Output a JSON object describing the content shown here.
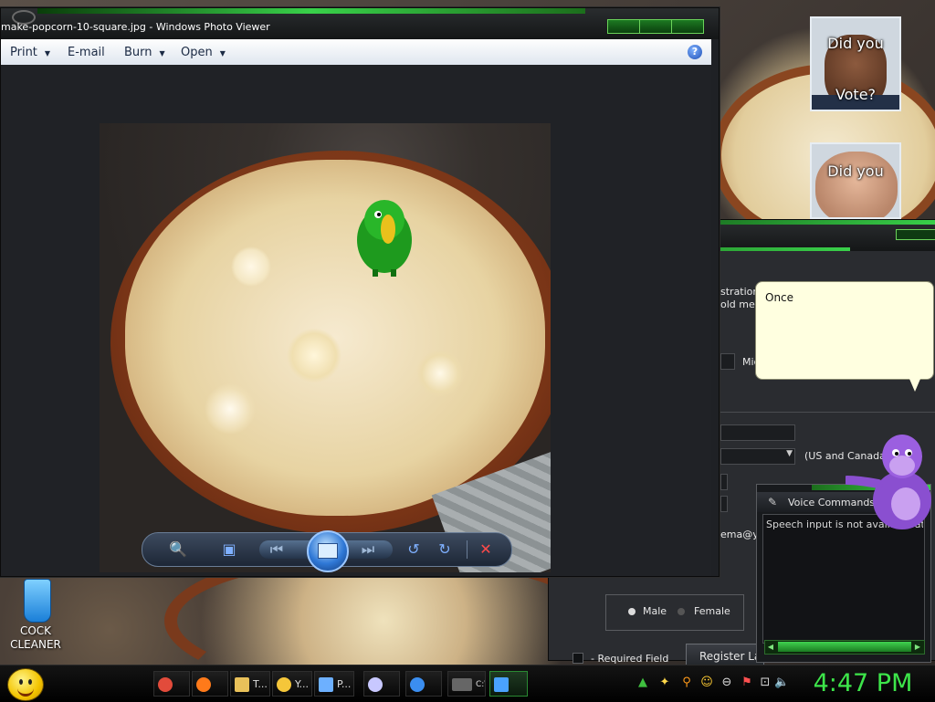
{
  "viewer": {
    "title": "make-popcorn-10-square.jpg - Windows Photo Viewer",
    "menu": [
      {
        "label": "Print",
        "has_arrow": true
      },
      {
        "label": "E-mail",
        "has_arrow": false
      },
      {
        "label": "Burn",
        "has_arrow": true
      },
      {
        "label": "Open",
        "has_arrow": true
      }
    ],
    "help_icon": "?",
    "toolbar": {
      "zoom_icon": "magnifier-icon",
      "fit_icon": "actual-size-icon",
      "prev_icon": "previous-icon",
      "slideshow_icon": "slideshow-icon",
      "next_icon": "next-icon",
      "rotate_ccw_icon": "rotate-counterclockwise-icon",
      "rotate_cw_icon": "rotate-clockwise-icon",
      "delete_icon": "delete-icon"
    }
  },
  "thumbs": [
    {
      "text_top": "Did you",
      "text_bottom": "Vote?"
    },
    {
      "text_top": "Did you"
    }
  ],
  "registration": {
    "line1": "stration i",
    "line2": "old me!",
    "mic_label": "Mic",
    "region_note": "(US and Canada Onl",
    "email_partial": "ema@y",
    "male": "Male",
    "female": "Female",
    "required_field": "- Required Field",
    "register_later": "Register Late"
  },
  "bubble": {
    "text": "Once"
  },
  "voice": {
    "title": "Voice Commands ...",
    "status": "Speech input is not available at this"
  },
  "desktop_icon": {
    "label_line1": "COCK",
    "label_line2": "CLEANER"
  },
  "taskbar": {
    "tasks": [
      {
        "name": "chrome",
        "label": "",
        "color": "#e24b3b"
      },
      {
        "name": "firefox",
        "label": "",
        "color": "#ff7a1a"
      },
      {
        "name": "explorer",
        "label": "T...",
        "color": "#e9c15a"
      },
      {
        "name": "yahoo",
        "label": "Y...",
        "color": "#f5c63a"
      },
      {
        "name": "presentation",
        "label": "P...",
        "color": "#6db0ff"
      },
      {
        "name": "paint",
        "label": "",
        "color": "#c8c8ff"
      },
      {
        "name": "ie",
        "label": "",
        "color": "#3b8ef0"
      },
      {
        "name": "cmd",
        "label": "C:\\",
        "color": "#666666"
      },
      {
        "name": "photo-viewer",
        "label": "",
        "color": "#4aa2ff"
      }
    ],
    "clock": "4:47 PM"
  },
  "colors": {
    "accent_green": "#39d14a",
    "clock_green": "#3de54a"
  }
}
